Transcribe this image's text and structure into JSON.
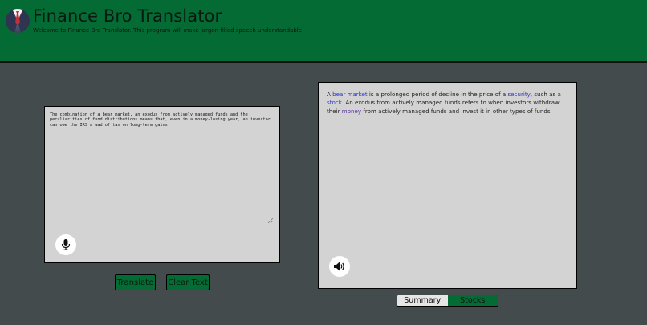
{
  "header": {
    "title": "Finance Bro Translator",
    "subtitle": "Welcome to Finance Bro Translator. This program will make jargon-filled speech understandable!",
    "logo_icon": "suit-tie-icon"
  },
  "input": {
    "text": "The combination of a bear market, an exodus from actively managed funds and the peculiarities of fund distributions means that, even in a money-losing year, an investor can owe the IRS a wad of tax on long-term gains.",
    "mic_icon": "microphone-icon"
  },
  "buttons": {
    "translate_label": "Translate",
    "clear_label": "Clear Text"
  },
  "output": {
    "segments": {
      "s1": "A ",
      "l1": "bear market",
      "s2": " is a prolonged period of decline in the price of a ",
      "l2": "security",
      "s3": ", such as a ",
      "l3": "stock",
      "s4": ". An exodus from actively managed funds refers to when investors withdraw their ",
      "l4": "money",
      "s5": " from actively managed funds and invest it in other types of funds"
    },
    "speaker_icon": "speaker-icon"
  },
  "tabs": {
    "summary_label": "Summary",
    "stocks_label": "Stocks",
    "active": "Summary"
  },
  "colors": {
    "header_bg": "#046b34",
    "page_bg": "#434b4d",
    "panel_bg": "#d3d3d3",
    "link": "#2c36c9",
    "link_visited": "#5a2fa0"
  }
}
